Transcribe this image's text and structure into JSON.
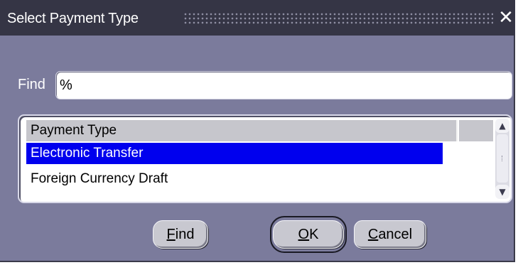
{
  "window": {
    "title": "Select Payment Type",
    "close_glyph": "✕"
  },
  "find": {
    "label": "Find",
    "value": "%"
  },
  "list": {
    "column_header": "Payment Type",
    "rows": [
      {
        "label": "Electronic Transfer",
        "selected": true
      },
      {
        "label": "Foreign Currency Draft",
        "selected": false
      }
    ]
  },
  "scrollbar": {
    "up_glyph": "▲",
    "down_glyph": "▼"
  },
  "buttons": {
    "find": {
      "mnemonic": "F",
      "rest": "ind"
    },
    "ok": {
      "mnemonic": "O",
      "rest": "K"
    },
    "cancel": {
      "mnemonic": "C",
      "rest": "ancel"
    }
  },
  "colors": {
    "window_bg": "#7b7b9c",
    "titlebar_bg": "#353545",
    "selection_bg": "#0000ee"
  }
}
